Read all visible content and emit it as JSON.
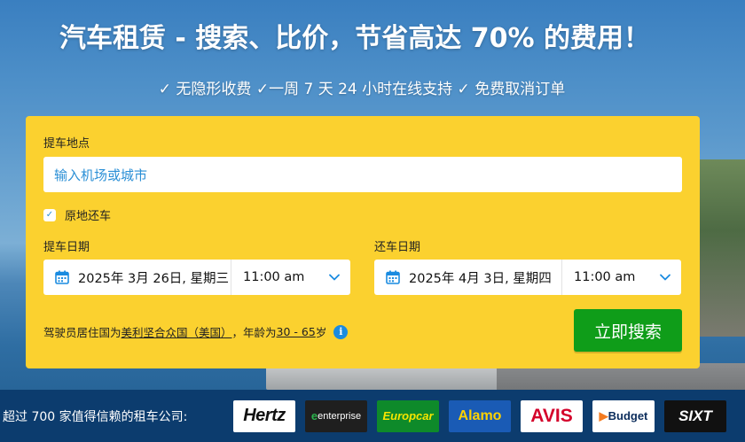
{
  "hero": {
    "headline": "汽车租赁 - 搜索、比价，节省高达 70% 的费用！",
    "subline": "✓ 无隐形收费 ✓一周 7 天 24 小时在线支持 ✓ 免费取消订单"
  },
  "form": {
    "pickup_location_label": "提车地点",
    "pickup_location_placeholder": "输入机场或城市",
    "same_location_label": "原地还车",
    "same_location_checked": true,
    "pickup_date_label": "提车日期",
    "pickup_date": "2025年 3月 26日, 星期三",
    "pickup_time": "11:00 am",
    "return_date_label": "还车日期",
    "return_date": "2025年 4月 3日, 星期四",
    "return_time": "11:00 am",
    "driver_note_prefix": "驾驶员居住国为",
    "driver_country": "美利坚合众国（美国）",
    "driver_note_mid": "，年龄为 ",
    "driver_age": "30 - 65",
    "driver_note_suffix": "岁",
    "search_button": "立即搜索"
  },
  "partners": {
    "label": "超过 700 家值得信赖的租车公司:",
    "logos": [
      "Hertz",
      "enterprise",
      "Europcar",
      "Alamo",
      "AVIS",
      "Budget",
      "SIXT"
    ]
  },
  "colors": {
    "panel_bg": "#fbd12f",
    "search_button": "#0f9d19",
    "bottom_bar": "#0c3c6e",
    "link_blue": "#2a8fd6"
  },
  "icons": {
    "checkbox": "check-icon",
    "date": "calendar-icon",
    "time": "chevron-down-icon",
    "info": "info-icon"
  }
}
